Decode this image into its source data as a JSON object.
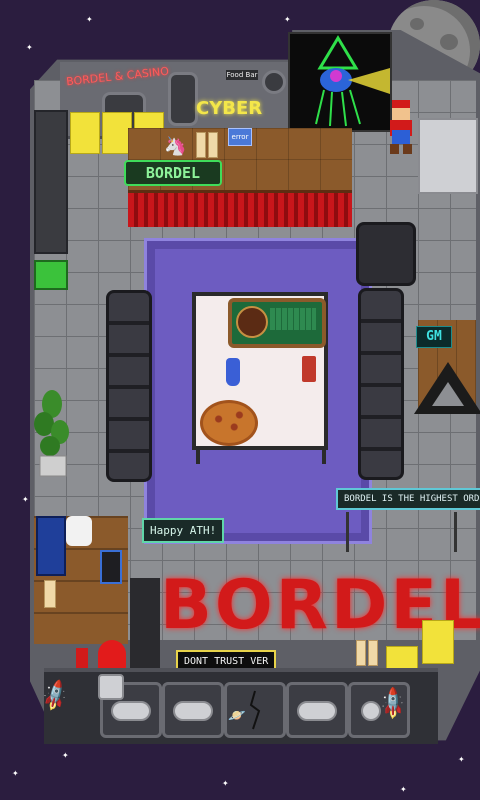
{
  "room": {
    "neon_top_left": "BORDEL & CASINO",
    "cyber_label": "CYBER",
    "food_bar_label": "Food Bar",
    "error_label": "error",
    "bar_sign": "BORDEL",
    "gm_sign": "GM",
    "big_sign": "BORDEL"
  },
  "signs": {
    "highest_order": "BORDEL IS THE HIGHEST ORDER",
    "happy_ath": "Happy ATH!",
    "dont_trust": "DONT TRUST VER"
  },
  "icons": {
    "rocket_left": "rocket-icon",
    "rocket_right": "rocket-icon",
    "moon": "moon-icon",
    "pacman_ghost": "ghost-icon",
    "planet": "planet-icon"
  },
  "colors": {
    "space": "#2b1d3f",
    "rug": "#6d5cc1",
    "neon_red": "#d21a1a",
    "neon_green": "#3fdc5a",
    "neon_yellow": "#f3e64a"
  }
}
